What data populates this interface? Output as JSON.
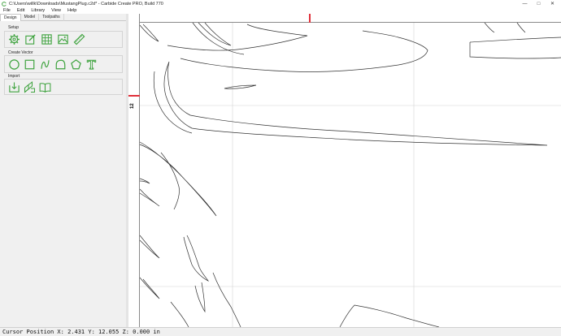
{
  "window": {
    "title": "C:\\Users\\willk\\Downloads\\MustangPlug.c2d* - Carbide Create PRO, Build 770",
    "minimize_icon": "minimize-icon",
    "maximize_icon": "maximize-icon",
    "close_icon": "close-icon"
  },
  "menu": {
    "file": "File",
    "edit": "Edit",
    "library": "Library",
    "view": "View",
    "help": "Help"
  },
  "tabs": {
    "design": "Design",
    "model": "Model",
    "toolpaths": "Toolpaths"
  },
  "groups": {
    "setup": "Setup",
    "create_vector": "Create Vector",
    "import": "Import"
  },
  "ruler": {
    "left_label": "12"
  },
  "status": {
    "text": "Cursor Position X: 2.431 Y: 12.055 Z: 0.000 in"
  },
  "colors": {
    "icon_green": "#3fa33f",
    "ruler_marker": "#e0303a",
    "grid": "#cfcfcf"
  }
}
